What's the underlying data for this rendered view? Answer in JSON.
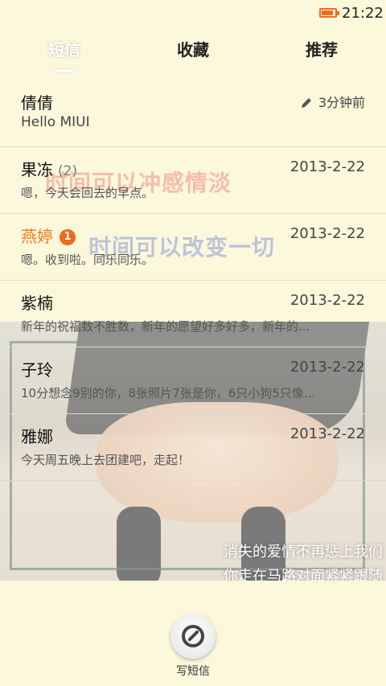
{
  "status": {
    "time": "21:22",
    "battery_level": 0.85
  },
  "tabs": [
    {
      "label": "短信",
      "active": true
    },
    {
      "label": "收藏",
      "active": false
    },
    {
      "label": "推荐",
      "active": false
    }
  ],
  "overlay": {
    "text1": "时间可以冲感情淡",
    "text2": "时间可以改变一切",
    "photo_caption1": "消失的爱情不再惩上我们",
    "photo_caption2": "你走在马路对面紧紧跟随"
  },
  "messages": [
    {
      "name": "倩倩",
      "count": "",
      "badge": "",
      "time": "3分钟前",
      "preview": "Hello MIUI",
      "unread": false
    },
    {
      "name": "果冻",
      "count": "(2)",
      "badge": "",
      "time": "2013-2-22",
      "preview": "嗯，今天会回去的早点。",
      "unread": false
    },
    {
      "name": "燕婷",
      "count": "",
      "badge": "1",
      "time": "2013-2-22",
      "preview": "嗯。收到啦。同乐同乐。",
      "unread": true
    },
    {
      "name": "紫楠",
      "count": "",
      "badge": "",
      "time": "2013-2-22",
      "preview": "新年的祝福数不胜数，新年的愿望好多好多，新年的...",
      "unread": false
    },
    {
      "name": "子玲",
      "count": "",
      "badge": "",
      "time": "2013-2-22",
      "preview": "10分想念9别的你，8张照片7张是你，6只小狗5只像...",
      "unread": false
    },
    {
      "name": "雅娜",
      "count": "",
      "badge": "",
      "time": "2013-2-22",
      "preview": "今天周五晚上去团建吧，走起！",
      "unread": false
    }
  ],
  "compose": {
    "label": "写短信"
  },
  "colors": {
    "accent": "#f07a1e",
    "badge": "#f06a1a",
    "background": "#fbf8dc"
  }
}
